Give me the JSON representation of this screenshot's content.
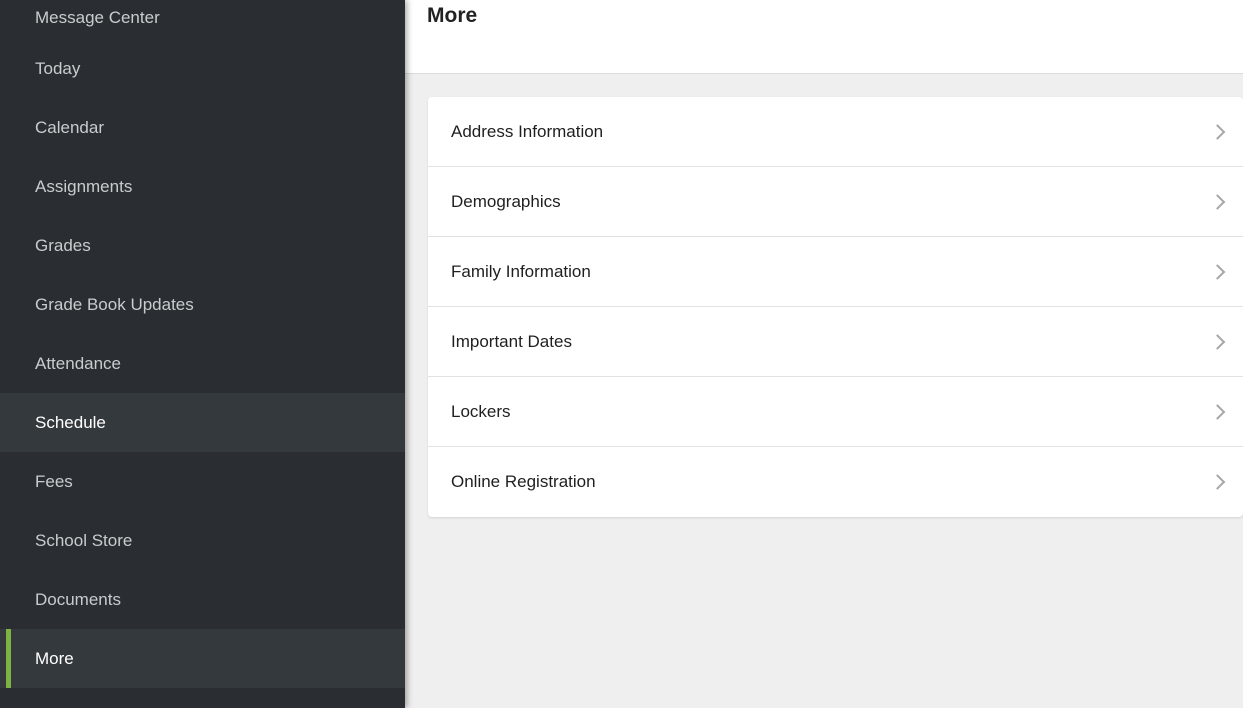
{
  "sidebar": {
    "items": [
      {
        "label": "Message Center"
      },
      {
        "label": "Today"
      },
      {
        "label": "Calendar"
      },
      {
        "label": "Assignments"
      },
      {
        "label": "Grades"
      },
      {
        "label": "Grade Book Updates"
      },
      {
        "label": "Attendance"
      },
      {
        "label": "Schedule"
      },
      {
        "label": "Fees"
      },
      {
        "label": "School Store"
      },
      {
        "label": "Documents"
      },
      {
        "label": "More"
      }
    ],
    "active_item": "More",
    "hover_item": "Schedule",
    "accent_color": "#7cb342",
    "background_color": "#2a2e32"
  },
  "header": {
    "title": "More"
  },
  "more_list": {
    "items": [
      {
        "label": "Address Information",
        "icon": "chevron-right-icon"
      },
      {
        "label": "Demographics",
        "icon": "chevron-right-icon"
      },
      {
        "label": "Family Information",
        "icon": "chevron-right-icon"
      },
      {
        "label": "Important Dates",
        "icon": "chevron-right-icon"
      },
      {
        "label": "Lockers",
        "icon": "chevron-right-icon"
      },
      {
        "label": "Online Registration",
        "icon": "chevron-right-icon"
      }
    ]
  }
}
